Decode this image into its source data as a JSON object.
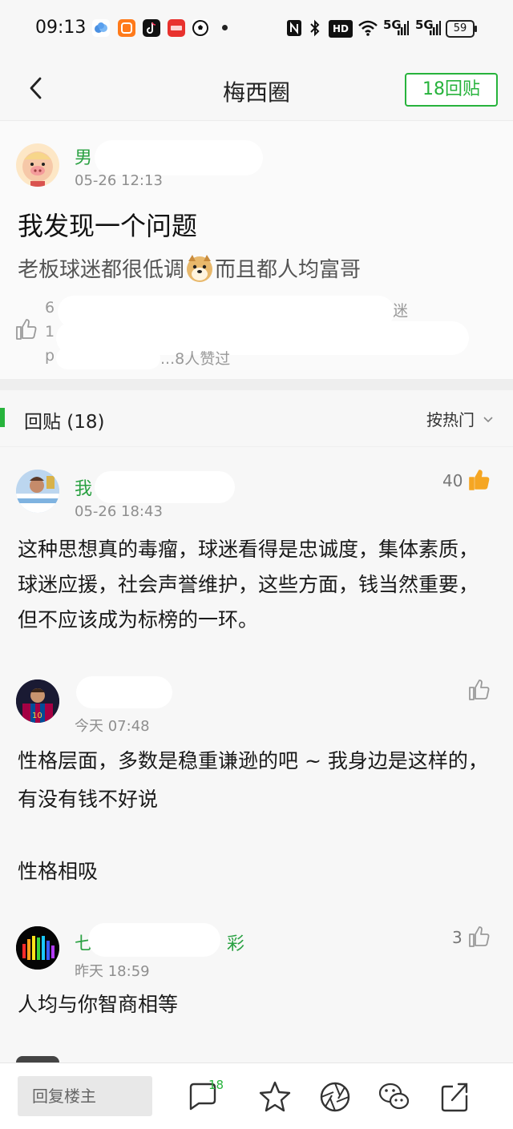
{
  "status_bar": {
    "time": "09:13",
    "hd_label": "HD",
    "signal_1": "5G",
    "signal_2": "5G",
    "battery": "59"
  },
  "nav": {
    "title": "梅西圈",
    "reply_button": "18回贴"
  },
  "post": {
    "author": "男",
    "timestamp": "05-26 12:13",
    "title": "我发现一个问题",
    "body_before_emoji": "老板球迷都很低调",
    "body_after_emoji": "而且都人均富哥",
    "likers_summary": "...8人赞过",
    "likers_partial_1": "迷",
    "likers_partial_2": "1",
    "likers_partial_3": "p"
  },
  "replies_header": {
    "label": "回贴 (18)",
    "sort": "按热门"
  },
  "replies": [
    {
      "author": "我",
      "timestamp": "05-26 18:43",
      "likes": "40",
      "body": "这种思想真的毒瘤，球迷看得是忠诚度，集体素质，球迷应援，社会声誉维护，这些方面，钱当然重要，但不应该成为标榜的一环。"
    },
    {
      "author": "",
      "timestamp": "今天 07:48",
      "likes": "",
      "body_line_1": "性格层面，多数是稳重谦逊的吧 ~ 我身边是这样的，有没有钱不好说",
      "body_line_2": "性格相吸"
    },
    {
      "author_start": "七",
      "author_end": "彩",
      "timestamp": "昨天 18:59",
      "likes": "3",
      "body": "人均与你智商相等"
    }
  ],
  "bottom_bar": {
    "reply_placeholder": "回复楼主",
    "comment_badge": "18"
  },
  "colors": {
    "accent_green": "#27b33c",
    "name_green": "#2aa142",
    "liked_orange": "#f5a623",
    "background": "#f7f7f7"
  }
}
